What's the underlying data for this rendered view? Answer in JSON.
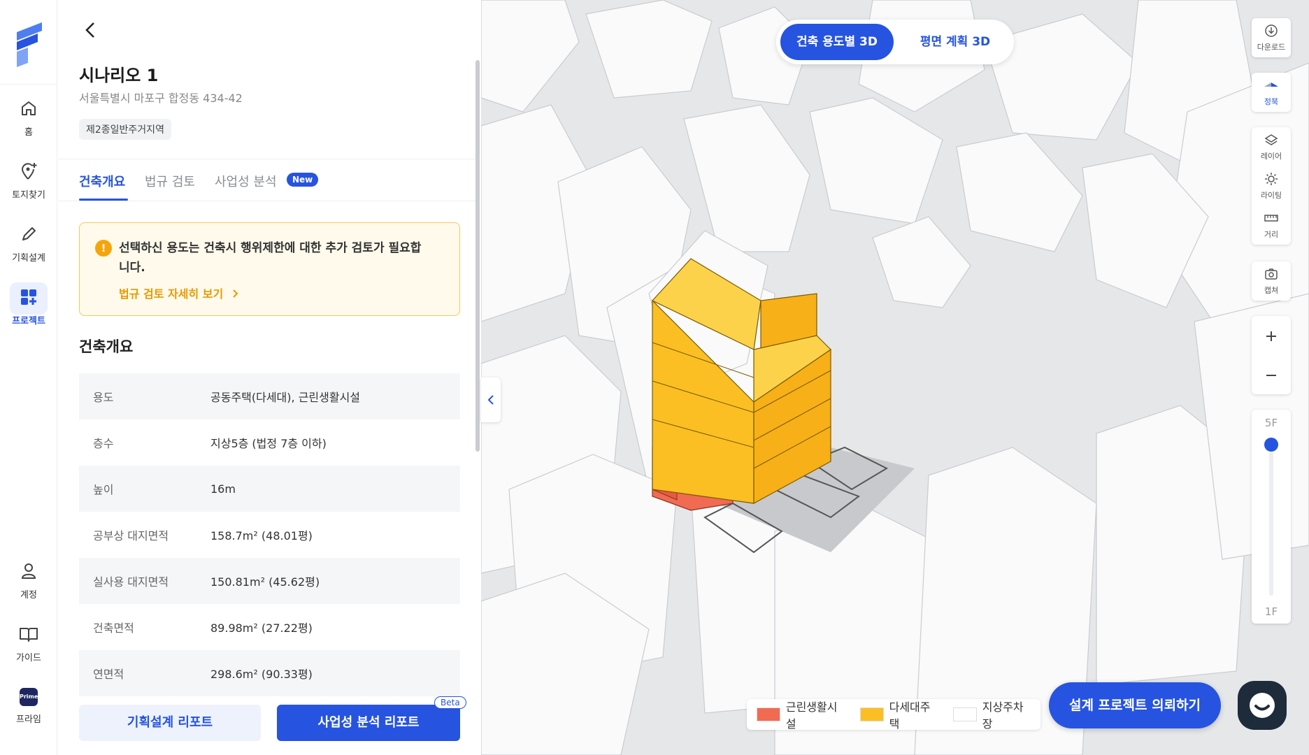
{
  "nav": {
    "items": [
      {
        "label": "홈",
        "icon": "home-icon"
      },
      {
        "label": "토지찾기",
        "icon": "location-plus-icon"
      },
      {
        "label": "기획설계",
        "icon": "pencil-icon"
      },
      {
        "label": "프로젝트",
        "icon": "grid-plus-icon"
      },
      {
        "label": "계정",
        "icon": "user-icon"
      },
      {
        "label": "가이드",
        "icon": "book-icon"
      },
      {
        "label": "프라임",
        "icon": "prime-icon"
      }
    ],
    "active_color": "#2654e0",
    "prime_badge": "Prime"
  },
  "panel": {
    "title": "시나리오 1",
    "address": "서울특별시 마포구 합정동 434-42",
    "zone": "제2종일반주거지역",
    "tabs": [
      {
        "label": "건축개요"
      },
      {
        "label": "법규 검토"
      },
      {
        "label": "사업성 분석"
      }
    ],
    "new_badge": "New",
    "warning": {
      "text": "선택하신 용도는 건축시 행위제한에 대한 추가 검토가 필요합니다.",
      "link": "법규 검토 자세히 보기"
    },
    "section_title": "건축개요",
    "rows": [
      {
        "key": "용도",
        "value": "공동주택(다세대), 근린생활시설"
      },
      {
        "key": "층수",
        "value": "지상5층 (법정 7층 이하)"
      },
      {
        "key": "높이",
        "value": "16m"
      },
      {
        "key": "공부상 대지면적",
        "value": "158.7m² (48.01평)"
      },
      {
        "key": "실사용 대지면적",
        "value": "150.81m² (45.62평)"
      },
      {
        "key": "건축면적",
        "value": "89.98m² (27.22평)"
      },
      {
        "key": "연면적",
        "value": "298.6m² (90.33평)"
      }
    ],
    "buttons": {
      "plan_report": "기획설계 리포트",
      "biz_report": "사업성 분석 리포트",
      "beta": "Beta"
    }
  },
  "map": {
    "view_toggle": {
      "active": "건축 용도별 3D",
      "other": "평면 계획 3D"
    },
    "tools": {
      "download": "다운로드",
      "north": "정북",
      "layer": "레이어",
      "lighting": "라이팅",
      "distance": "거리",
      "capture": "캡쳐"
    },
    "floor": {
      "top": "5F",
      "bottom": "1F",
      "current": 5,
      "min": 1,
      "max": 5
    },
    "legend": [
      {
        "label": "근린생활시설",
        "color": "#f06b52"
      },
      {
        "label": "다세대주택",
        "color": "#fbbf24"
      },
      {
        "label": "지상주차장",
        "color": "#ffffff"
      }
    ],
    "cta": "설계 프로젝트 의뢰하기"
  }
}
